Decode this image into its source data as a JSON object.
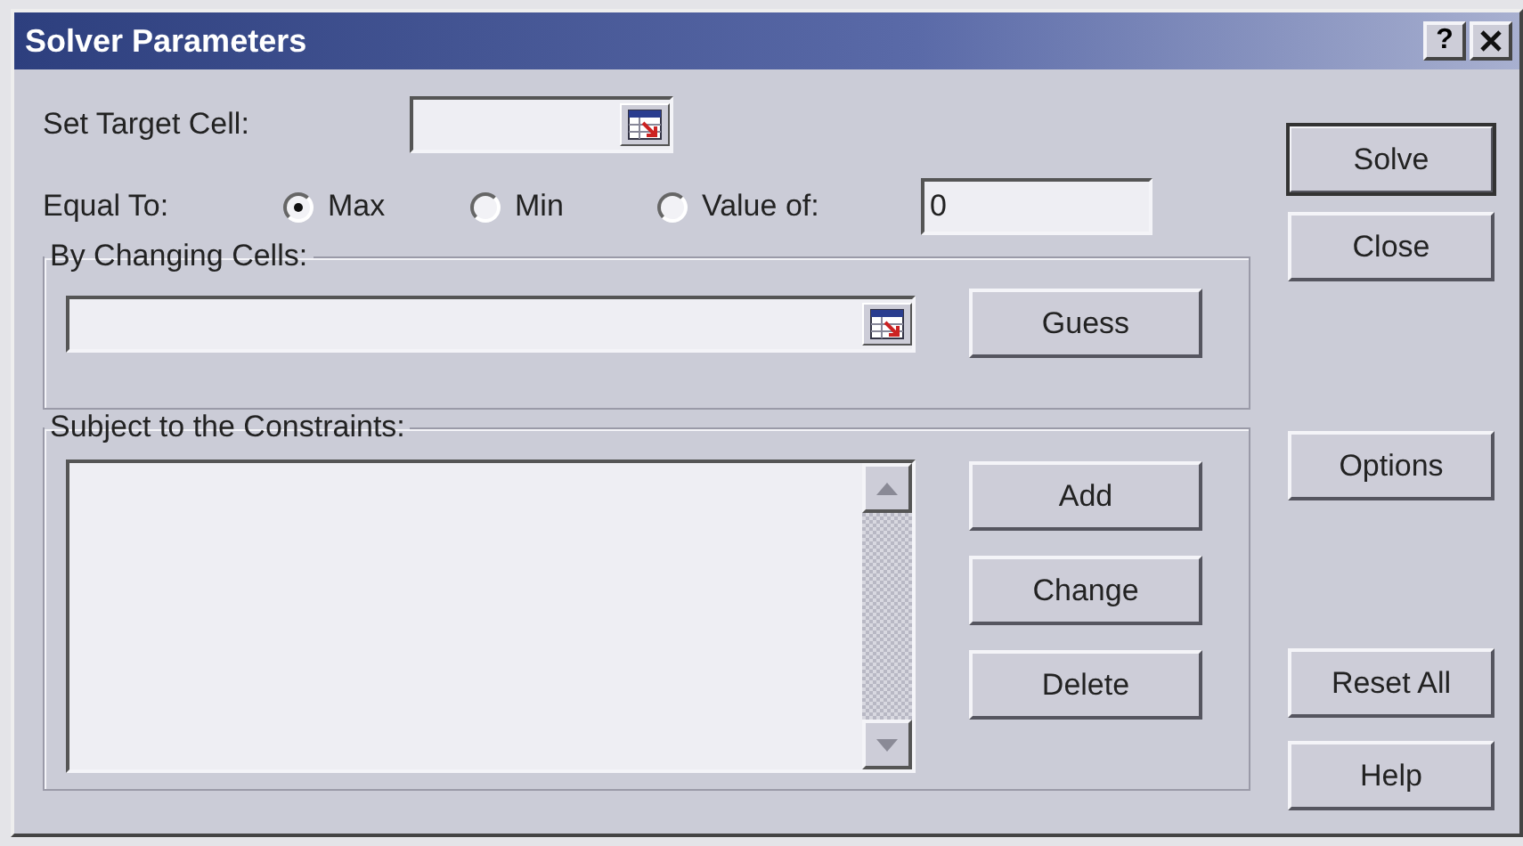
{
  "window": {
    "title": "Solver Parameters",
    "help_button": "?"
  },
  "target_cell": {
    "label": "Set Target Cell:"
  },
  "equal_to": {
    "label": "Equal To:",
    "value": "0",
    "options": [
      {
        "label": "Max",
        "selected": true
      },
      {
        "label": "Min",
        "selected": false
      },
      {
        "label": "Value of:",
        "selected": false
      }
    ]
  },
  "changing_cells": {
    "title": "By Changing Cells:",
    "button": "Guess"
  },
  "constraints": {
    "title": "Subject to the Constraints:",
    "buttons": [
      "Add",
      "Change",
      "Delete"
    ]
  },
  "side_buttons": [
    {
      "label": "Solve",
      "default": true
    },
    {
      "label": "Close",
      "default": false
    },
    {
      "label": "Options",
      "default": false
    },
    {
      "label": "Reset All",
      "default": false
    },
    {
      "label": "Help",
      "default": false
    }
  ]
}
